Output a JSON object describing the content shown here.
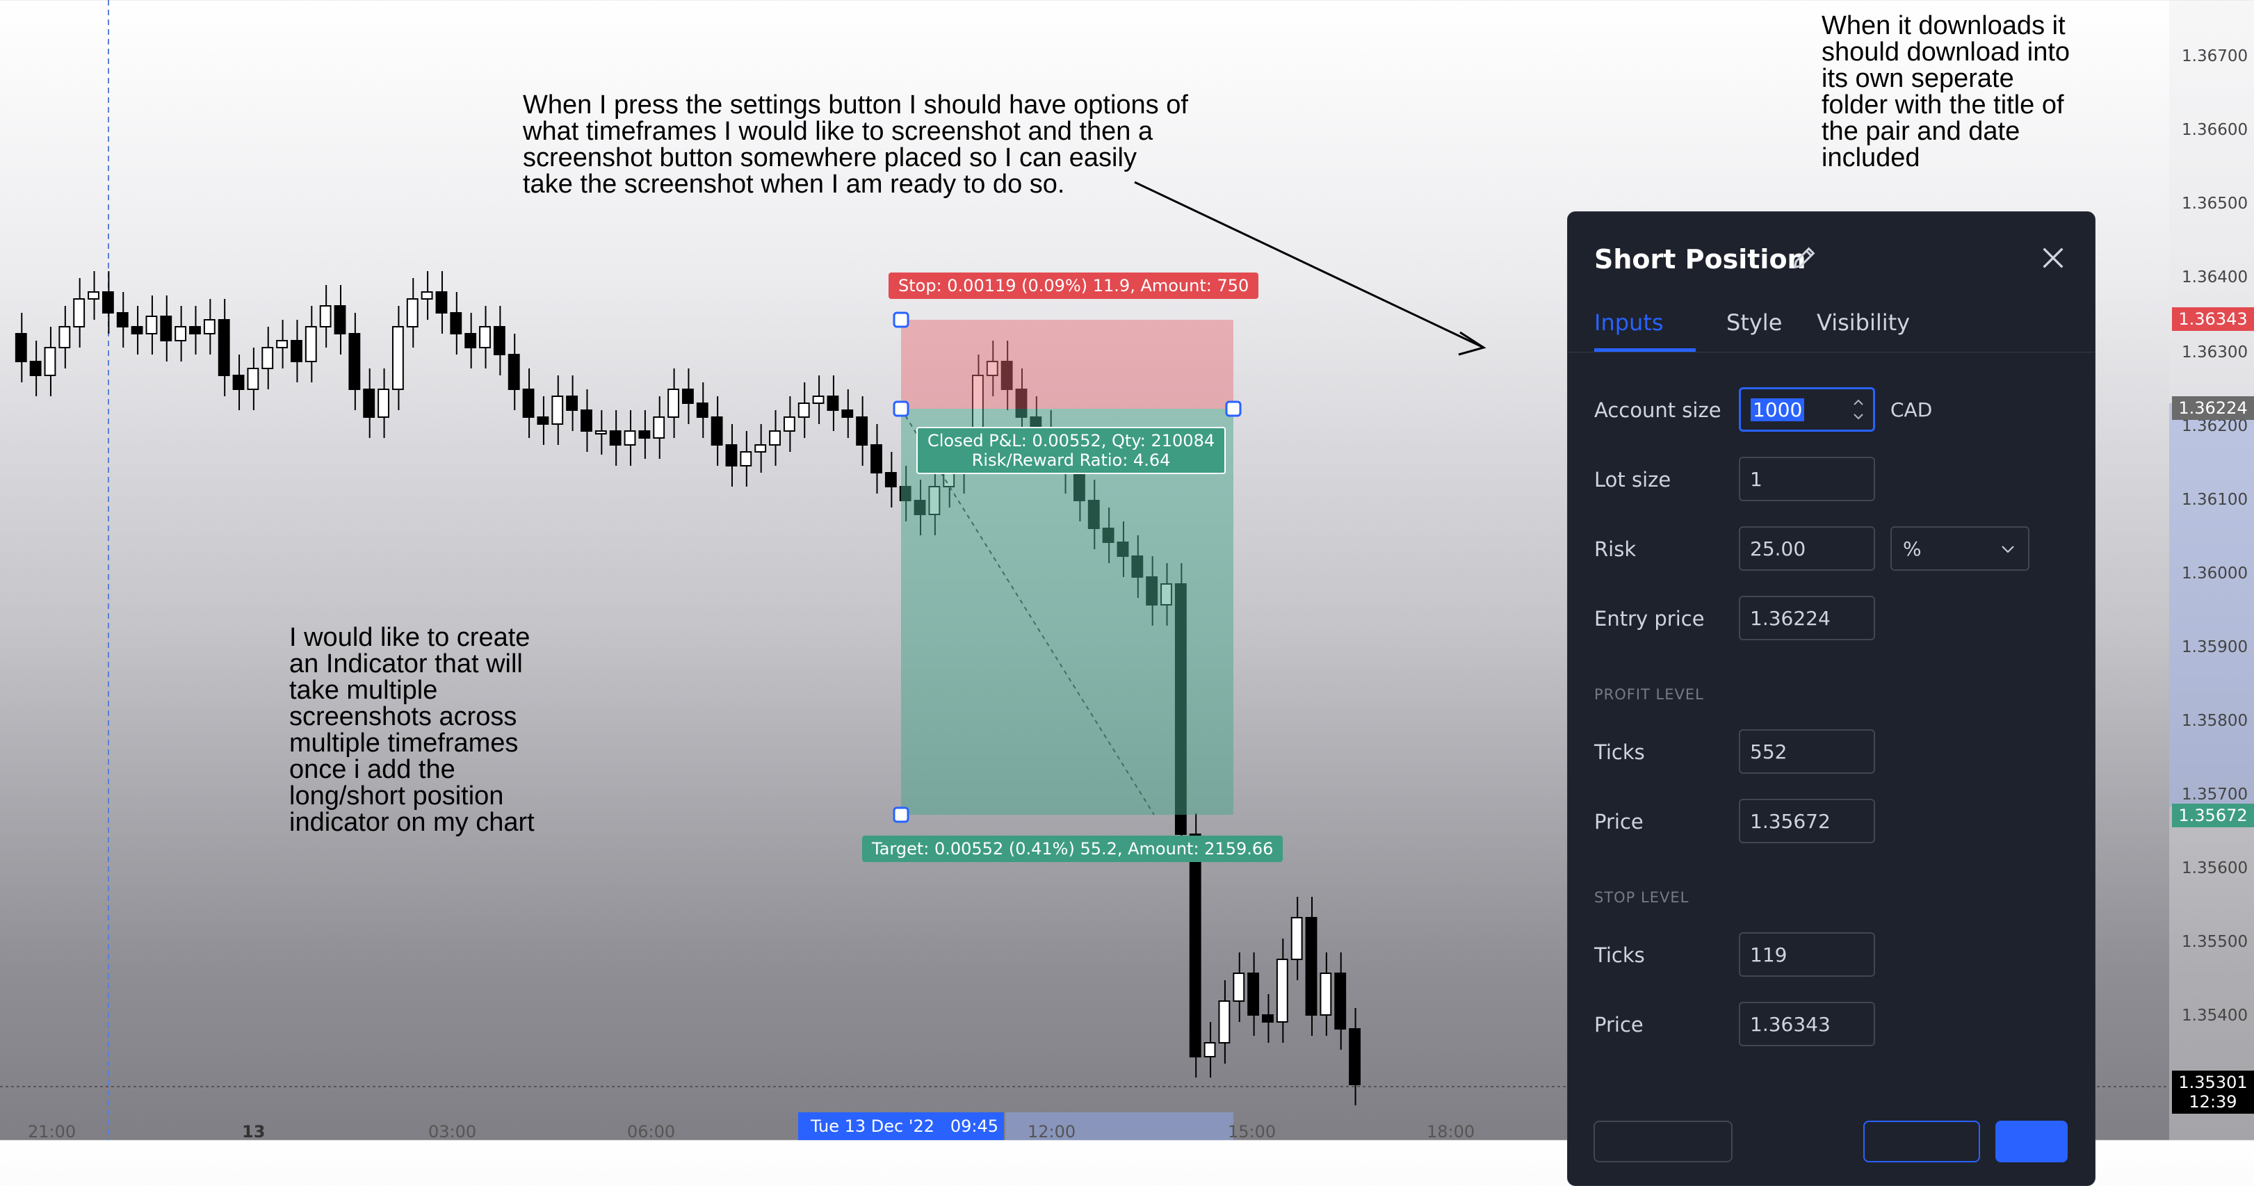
{
  "notes": {
    "settings": "When I press the settings button I should have options of\nwhat timeframes I would like to screenshot and then a\nscreenshot button somewhere placed so I can easily\ntake the screenshot when I am ready to do so.",
    "indicator": "I would like to create\nan Indicator that will\ntake multiple\nscreenshots across\nmultiple timeframes\nonce i add the\nlong/short position\nindicator on my chart",
    "download": "When it downloads it\nshould download into\nits own seperate\nfolder with the title of\nthe pair and date\nincluded"
  },
  "chart": {
    "stop_label": "Stop: 0.00119 (0.09%) 11.9, Amount: 750",
    "closed_pnl": "Closed P&L: 0.00552, Qty: 210084",
    "risk_reward": "Risk/Reward Ratio: 4.64",
    "target_label": "Target: 0.00552 (0.41%) 55.2, Amount: 2159.66",
    "date_chip": "Tue 13 Dec '22   09:45",
    "time_axis": [
      "21:00",
      "13",
      "03:00",
      "06:00",
      "12:00",
      "15:00",
      "18:00"
    ],
    "price_axis": [
      "1.36700",
      "1.36600",
      "1.36500",
      "1.36400",
      "1.36300",
      "1.36200",
      "1.36100",
      "1.36000",
      "1.35900",
      "1.35800",
      "1.35700",
      "1.35600",
      "1.35500",
      "1.35400"
    ],
    "tags": {
      "stop_price": "1.36343",
      "entry_price": "1.36224",
      "target_price": "1.35672",
      "current_price": "1.35301",
      "countdown": "12:39"
    },
    "colors": {
      "stop": "#e24a4f",
      "target": "#3e9c82",
      "entry": "#6b6b6b",
      "accent": "#2962ff"
    }
  },
  "panel": {
    "title": "Short Position",
    "tabs": [
      "Inputs",
      "Style",
      "Visibility"
    ],
    "active_tab": "Inputs",
    "account_size": {
      "label": "Account size",
      "value": "1000",
      "currency": "CAD"
    },
    "lot_size": {
      "label": "Lot size",
      "value": "1"
    },
    "risk": {
      "label": "Risk",
      "value": "25.00",
      "unit": "%"
    },
    "entry_price": {
      "label": "Entry price",
      "value": "1.36224"
    },
    "profit_section": "PROFIT LEVEL",
    "profit_ticks": {
      "label": "Ticks",
      "value": "552"
    },
    "profit_price": {
      "label": "Price",
      "value": "1.35672"
    },
    "stop_section": "STOP LEVEL",
    "stop_ticks": {
      "label": "Ticks",
      "value": "119"
    },
    "stop_price": {
      "label": "Price",
      "value": "1.36343"
    }
  }
}
